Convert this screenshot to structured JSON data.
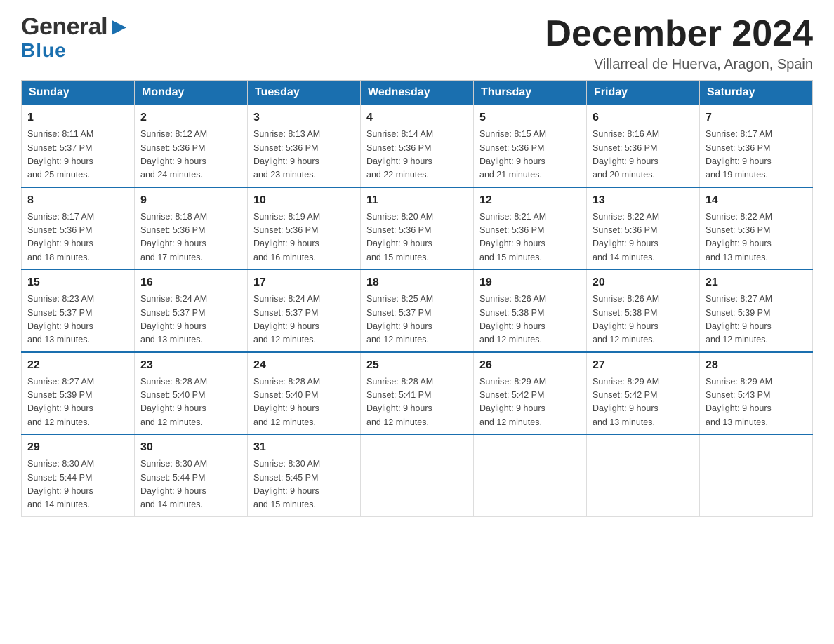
{
  "header": {
    "logo_line1": "General▶",
    "logo_line2": "Blue",
    "title": "December 2024",
    "location": "Villarreal de Huerva, Aragon, Spain"
  },
  "calendar": {
    "days_of_week": [
      "Sunday",
      "Monday",
      "Tuesday",
      "Wednesday",
      "Thursday",
      "Friday",
      "Saturday"
    ],
    "weeks": [
      [
        {
          "day": "1",
          "sunrise": "Sunrise: 8:11 AM",
          "sunset": "Sunset: 5:37 PM",
          "daylight": "Daylight: 9 hours",
          "daylight2": "and 25 minutes."
        },
        {
          "day": "2",
          "sunrise": "Sunrise: 8:12 AM",
          "sunset": "Sunset: 5:36 PM",
          "daylight": "Daylight: 9 hours",
          "daylight2": "and 24 minutes."
        },
        {
          "day": "3",
          "sunrise": "Sunrise: 8:13 AM",
          "sunset": "Sunset: 5:36 PM",
          "daylight": "Daylight: 9 hours",
          "daylight2": "and 23 minutes."
        },
        {
          "day": "4",
          "sunrise": "Sunrise: 8:14 AM",
          "sunset": "Sunset: 5:36 PM",
          "daylight": "Daylight: 9 hours",
          "daylight2": "and 22 minutes."
        },
        {
          "day": "5",
          "sunrise": "Sunrise: 8:15 AM",
          "sunset": "Sunset: 5:36 PM",
          "daylight": "Daylight: 9 hours",
          "daylight2": "and 21 minutes."
        },
        {
          "day": "6",
          "sunrise": "Sunrise: 8:16 AM",
          "sunset": "Sunset: 5:36 PM",
          "daylight": "Daylight: 9 hours",
          "daylight2": "and 20 minutes."
        },
        {
          "day": "7",
          "sunrise": "Sunrise: 8:17 AM",
          "sunset": "Sunset: 5:36 PM",
          "daylight": "Daylight: 9 hours",
          "daylight2": "and 19 minutes."
        }
      ],
      [
        {
          "day": "8",
          "sunrise": "Sunrise: 8:17 AM",
          "sunset": "Sunset: 5:36 PM",
          "daylight": "Daylight: 9 hours",
          "daylight2": "and 18 minutes."
        },
        {
          "day": "9",
          "sunrise": "Sunrise: 8:18 AM",
          "sunset": "Sunset: 5:36 PM",
          "daylight": "Daylight: 9 hours",
          "daylight2": "and 17 minutes."
        },
        {
          "day": "10",
          "sunrise": "Sunrise: 8:19 AM",
          "sunset": "Sunset: 5:36 PM",
          "daylight": "Daylight: 9 hours",
          "daylight2": "and 16 minutes."
        },
        {
          "day": "11",
          "sunrise": "Sunrise: 8:20 AM",
          "sunset": "Sunset: 5:36 PM",
          "daylight": "Daylight: 9 hours",
          "daylight2": "and 15 minutes."
        },
        {
          "day": "12",
          "sunrise": "Sunrise: 8:21 AM",
          "sunset": "Sunset: 5:36 PM",
          "daylight": "Daylight: 9 hours",
          "daylight2": "and 15 minutes."
        },
        {
          "day": "13",
          "sunrise": "Sunrise: 8:22 AM",
          "sunset": "Sunset: 5:36 PM",
          "daylight": "Daylight: 9 hours",
          "daylight2": "and 14 minutes."
        },
        {
          "day": "14",
          "sunrise": "Sunrise: 8:22 AM",
          "sunset": "Sunset: 5:36 PM",
          "daylight": "Daylight: 9 hours",
          "daylight2": "and 13 minutes."
        }
      ],
      [
        {
          "day": "15",
          "sunrise": "Sunrise: 8:23 AM",
          "sunset": "Sunset: 5:37 PM",
          "daylight": "Daylight: 9 hours",
          "daylight2": "and 13 minutes."
        },
        {
          "day": "16",
          "sunrise": "Sunrise: 8:24 AM",
          "sunset": "Sunset: 5:37 PM",
          "daylight": "Daylight: 9 hours",
          "daylight2": "and 13 minutes."
        },
        {
          "day": "17",
          "sunrise": "Sunrise: 8:24 AM",
          "sunset": "Sunset: 5:37 PM",
          "daylight": "Daylight: 9 hours",
          "daylight2": "and 12 minutes."
        },
        {
          "day": "18",
          "sunrise": "Sunrise: 8:25 AM",
          "sunset": "Sunset: 5:37 PM",
          "daylight": "Daylight: 9 hours",
          "daylight2": "and 12 minutes."
        },
        {
          "day": "19",
          "sunrise": "Sunrise: 8:26 AM",
          "sunset": "Sunset: 5:38 PM",
          "daylight": "Daylight: 9 hours",
          "daylight2": "and 12 minutes."
        },
        {
          "day": "20",
          "sunrise": "Sunrise: 8:26 AM",
          "sunset": "Sunset: 5:38 PM",
          "daylight": "Daylight: 9 hours",
          "daylight2": "and 12 minutes."
        },
        {
          "day": "21",
          "sunrise": "Sunrise: 8:27 AM",
          "sunset": "Sunset: 5:39 PM",
          "daylight": "Daylight: 9 hours",
          "daylight2": "and 12 minutes."
        }
      ],
      [
        {
          "day": "22",
          "sunrise": "Sunrise: 8:27 AM",
          "sunset": "Sunset: 5:39 PM",
          "daylight": "Daylight: 9 hours",
          "daylight2": "and 12 minutes."
        },
        {
          "day": "23",
          "sunrise": "Sunrise: 8:28 AM",
          "sunset": "Sunset: 5:40 PM",
          "daylight": "Daylight: 9 hours",
          "daylight2": "and 12 minutes."
        },
        {
          "day": "24",
          "sunrise": "Sunrise: 8:28 AM",
          "sunset": "Sunset: 5:40 PM",
          "daylight": "Daylight: 9 hours",
          "daylight2": "and 12 minutes."
        },
        {
          "day": "25",
          "sunrise": "Sunrise: 8:28 AM",
          "sunset": "Sunset: 5:41 PM",
          "daylight": "Daylight: 9 hours",
          "daylight2": "and 12 minutes."
        },
        {
          "day": "26",
          "sunrise": "Sunrise: 8:29 AM",
          "sunset": "Sunset: 5:42 PM",
          "daylight": "Daylight: 9 hours",
          "daylight2": "and 12 minutes."
        },
        {
          "day": "27",
          "sunrise": "Sunrise: 8:29 AM",
          "sunset": "Sunset: 5:42 PM",
          "daylight": "Daylight: 9 hours",
          "daylight2": "and 13 minutes."
        },
        {
          "day": "28",
          "sunrise": "Sunrise: 8:29 AM",
          "sunset": "Sunset: 5:43 PM",
          "daylight": "Daylight: 9 hours",
          "daylight2": "and 13 minutes."
        }
      ],
      [
        {
          "day": "29",
          "sunrise": "Sunrise: 8:30 AM",
          "sunset": "Sunset: 5:44 PM",
          "daylight": "Daylight: 9 hours",
          "daylight2": "and 14 minutes."
        },
        {
          "day": "30",
          "sunrise": "Sunrise: 8:30 AM",
          "sunset": "Sunset: 5:44 PM",
          "daylight": "Daylight: 9 hours",
          "daylight2": "and 14 minutes."
        },
        {
          "day": "31",
          "sunrise": "Sunrise: 8:30 AM",
          "sunset": "Sunset: 5:45 PM",
          "daylight": "Daylight: 9 hours",
          "daylight2": "and 15 minutes."
        },
        null,
        null,
        null,
        null
      ]
    ]
  }
}
